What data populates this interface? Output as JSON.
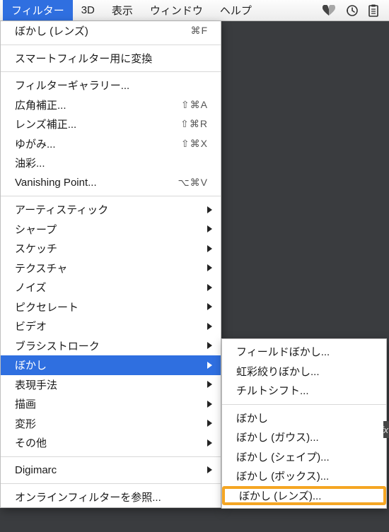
{
  "menubar": {
    "items": [
      "フィルター",
      "3D",
      "表示",
      "ウィンドウ",
      "ヘルプ"
    ],
    "active_index": 0
  },
  "menu": {
    "section0": [
      {
        "label": "ぼかし (レンズ)",
        "shortcut": "⌘F"
      }
    ],
    "section1": [
      {
        "label": "スマートフィルター用に変換"
      }
    ],
    "section2": [
      {
        "label": "フィルターギャラリー..."
      },
      {
        "label": "広角補正...",
        "shortcut": "⇧⌘A"
      },
      {
        "label": "レンズ補正...",
        "shortcut": "⇧⌘R"
      },
      {
        "label": "ゆがみ...",
        "shortcut": "⇧⌘X"
      },
      {
        "label": "油彩..."
      },
      {
        "label": "Vanishing Point...",
        "shortcut": "⌥⌘V"
      }
    ],
    "section3": [
      {
        "label": "アーティスティック",
        "submenu": true
      },
      {
        "label": "シャープ",
        "submenu": true
      },
      {
        "label": "スケッチ",
        "submenu": true
      },
      {
        "label": "テクスチャ",
        "submenu": true
      },
      {
        "label": "ノイズ",
        "submenu": true
      },
      {
        "label": "ピクセレート",
        "submenu": true
      },
      {
        "label": "ビデオ",
        "submenu": true
      },
      {
        "label": "ブラシストローク",
        "submenu": true
      },
      {
        "label": "ぼかし",
        "submenu": true,
        "selected": true
      },
      {
        "label": "表現手法",
        "submenu": true
      },
      {
        "label": "描画",
        "submenu": true
      },
      {
        "label": "変形",
        "submenu": true
      },
      {
        "label": "その他",
        "submenu": true
      }
    ],
    "section4": [
      {
        "label": "Digimarc",
        "submenu": true
      }
    ],
    "section5": [
      {
        "label": "オンラインフィルターを参照..."
      }
    ]
  },
  "submenu": {
    "group0": [
      {
        "label": "フィールドぼかし..."
      },
      {
        "label": "虹彩絞りぼかし..."
      },
      {
        "label": "チルトシフト..."
      }
    ],
    "group1": [
      {
        "label": "ぼかし"
      },
      {
        "label": "ぼかし (ガウス)..."
      },
      {
        "label": "ぼかし (シェイプ)..."
      },
      {
        "label": "ぼかし (ボックス)..."
      },
      {
        "label": "ぼかし (レンズ)...",
        "highlighted": true
      }
    ]
  },
  "fx_label": "fx"
}
